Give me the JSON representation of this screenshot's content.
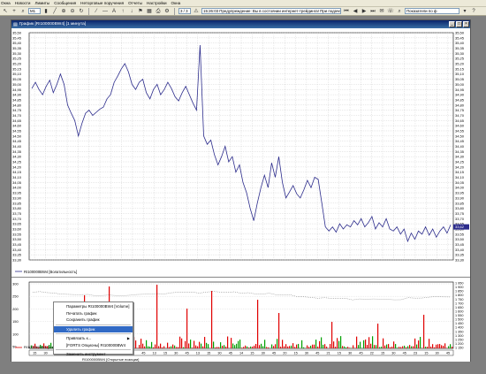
{
  "menubar": {
    "items": [
      "Окна",
      "Новости",
      "Лимиты",
      "Сообщения",
      "Неторговые поручения",
      "Отчеты",
      "Настройки",
      "Окна"
    ]
  },
  "toolbar": {
    "interval": "M1",
    "counter": "3 / 3",
    "message": "15:26:03  Предупреждение: Вы в состоянии интернет-трейдинга!   При подаче пор",
    "search_placeholder": "Показатели по ф"
  },
  "window": {
    "title": "График [RI100000BW4]   [1 минута]"
  },
  "price_panel": {
    "y_labels": [
      "35,50",
      "35,45",
      "35,40",
      "35,35",
      "35,30",
      "35,25",
      "35,20",
      "35,15",
      "35,10",
      "35,05",
      "35,00",
      "34,95",
      "34,90",
      "34,85",
      "34,80",
      "34,75",
      "34,70",
      "34,65",
      "34,60",
      "34,55",
      "34,50",
      "34,45",
      "34,40",
      "34,35",
      "34,30",
      "34,25",
      "34,20",
      "34,15",
      "34,10",
      "34,05",
      "34,00",
      "33,95",
      "33,90",
      "33,85",
      "33,80",
      "33,75",
      "33,70",
      "33,65",
      "33,60",
      "33,55",
      "33,50",
      "33,45",
      "33,40",
      "33,35",
      "33,30"
    ],
    "current_value": "33,62",
    "legend": "RI100000BW4 [Волатильность]"
  },
  "volume_panel": {
    "y_labels_left": [
      "300",
      "250",
      "200",
      "150",
      "100",
      "50"
    ],
    "y_labels_right": [
      "1 950",
      "1 900",
      "1 850",
      "1 800",
      "1 750",
      "1 700",
      "1 650",
      "1 600",
      "1 550",
      "1 500",
      "1 450",
      "1 400",
      "1 350",
      "1 300",
      "1 250",
      "1 200",
      "1 150"
    ],
    "legend_line1": "RI100000BW4 [Volume]",
    "legend_line2": "RI100000BW4 [Открытые позиции]"
  },
  "time_axis": {
    "labels": [
      "15",
      "30",
      "45",
      "16",
      "15",
      "30",
      "45",
      "18",
      "15",
      "30",
      "45",
      "13",
      "15",
      "30",
      "45",
      "13",
      "15",
      "30",
      "45",
      "14",
      "15",
      "30",
      "45",
      "20",
      "15",
      "30",
      "45",
      "21",
      "15",
      "30",
      "45",
      "22",
      "15",
      "30",
      "45",
      "23",
      "15",
      "30",
      "45"
    ]
  },
  "context_menu": {
    "items": [
      {
        "label": "Параметры RI100000BW4 [Volume]",
        "selected": false,
        "submenu": false
      },
      {
        "label": "Печатать график",
        "selected": false,
        "submenu": false
      },
      {
        "label": "Сохранить график",
        "selected": false,
        "submenu": false
      },
      {
        "label": "Удалить график",
        "selected": true,
        "submenu": false
      },
      {
        "label": "Привязать к...",
        "selected": false,
        "submenu": true
      },
      {
        "label": "[FORTS Опционы] RI100000BW4",
        "selected": false,
        "submenu": false
      },
      {
        "label": "Заменить инструмент",
        "selected": false,
        "submenu": false
      }
    ]
  },
  "chart_data": {
    "type": "line",
    "ylim": [
      33.3,
      35.5
    ],
    "y": [
      34.96,
      35.02,
      34.95,
      34.9,
      34.98,
      35.04,
      34.92,
      35.0,
      35.1,
      35.0,
      34.8,
      34.72,
      34.65,
      34.5,
      34.62,
      34.72,
      34.75,
      34.7,
      34.73,
      34.76,
      34.78,
      34.86,
      34.9,
      35.02,
      35.08,
      35.15,
      35.2,
      35.12,
      35.0,
      34.95,
      35.02,
      35.05,
      34.92,
      34.86,
      34.95,
      35.0,
      34.9,
      34.95,
      35.02,
      34.96,
      34.88,
      34.84,
      34.92,
      34.98,
      34.9,
      34.82,
      34.75,
      35.38,
      34.5,
      34.42,
      34.46,
      34.32,
      34.22,
      34.3,
      34.4,
      34.25,
      34.3,
      34.15,
      34.22,
      34.05,
      33.95,
      33.8,
      33.68,
      33.85,
      34.0,
      34.12,
      34.0,
      34.24,
      34.1,
      34.3,
      34.05,
      33.9,
      33.96,
      34.02,
      33.94,
      33.9,
      33.98,
      34.07,
      34.0,
      34.1,
      34.08,
      33.85,
      33.62,
      33.58,
      33.62,
      33.57,
      33.65,
      33.6,
      33.64,
      33.62,
      33.68,
      33.64,
      33.7,
      33.62,
      33.66,
      33.72,
      33.6,
      33.66,
      33.62,
      33.7,
      33.6,
      33.58,
      33.62,
      33.55,
      33.6,
      33.48,
      33.56,
      33.5,
      33.58,
      33.55,
      33.62,
      33.54,
      33.6,
      33.52,
      33.58,
      33.62,
      33.56,
      33.64
    ]
  },
  "colors": {
    "price_line": "#2c2c8c",
    "volume_up": "#00a000",
    "volume_down": "#e00000",
    "titlebar": "#0a246a",
    "selected_item": "#316ac5"
  }
}
